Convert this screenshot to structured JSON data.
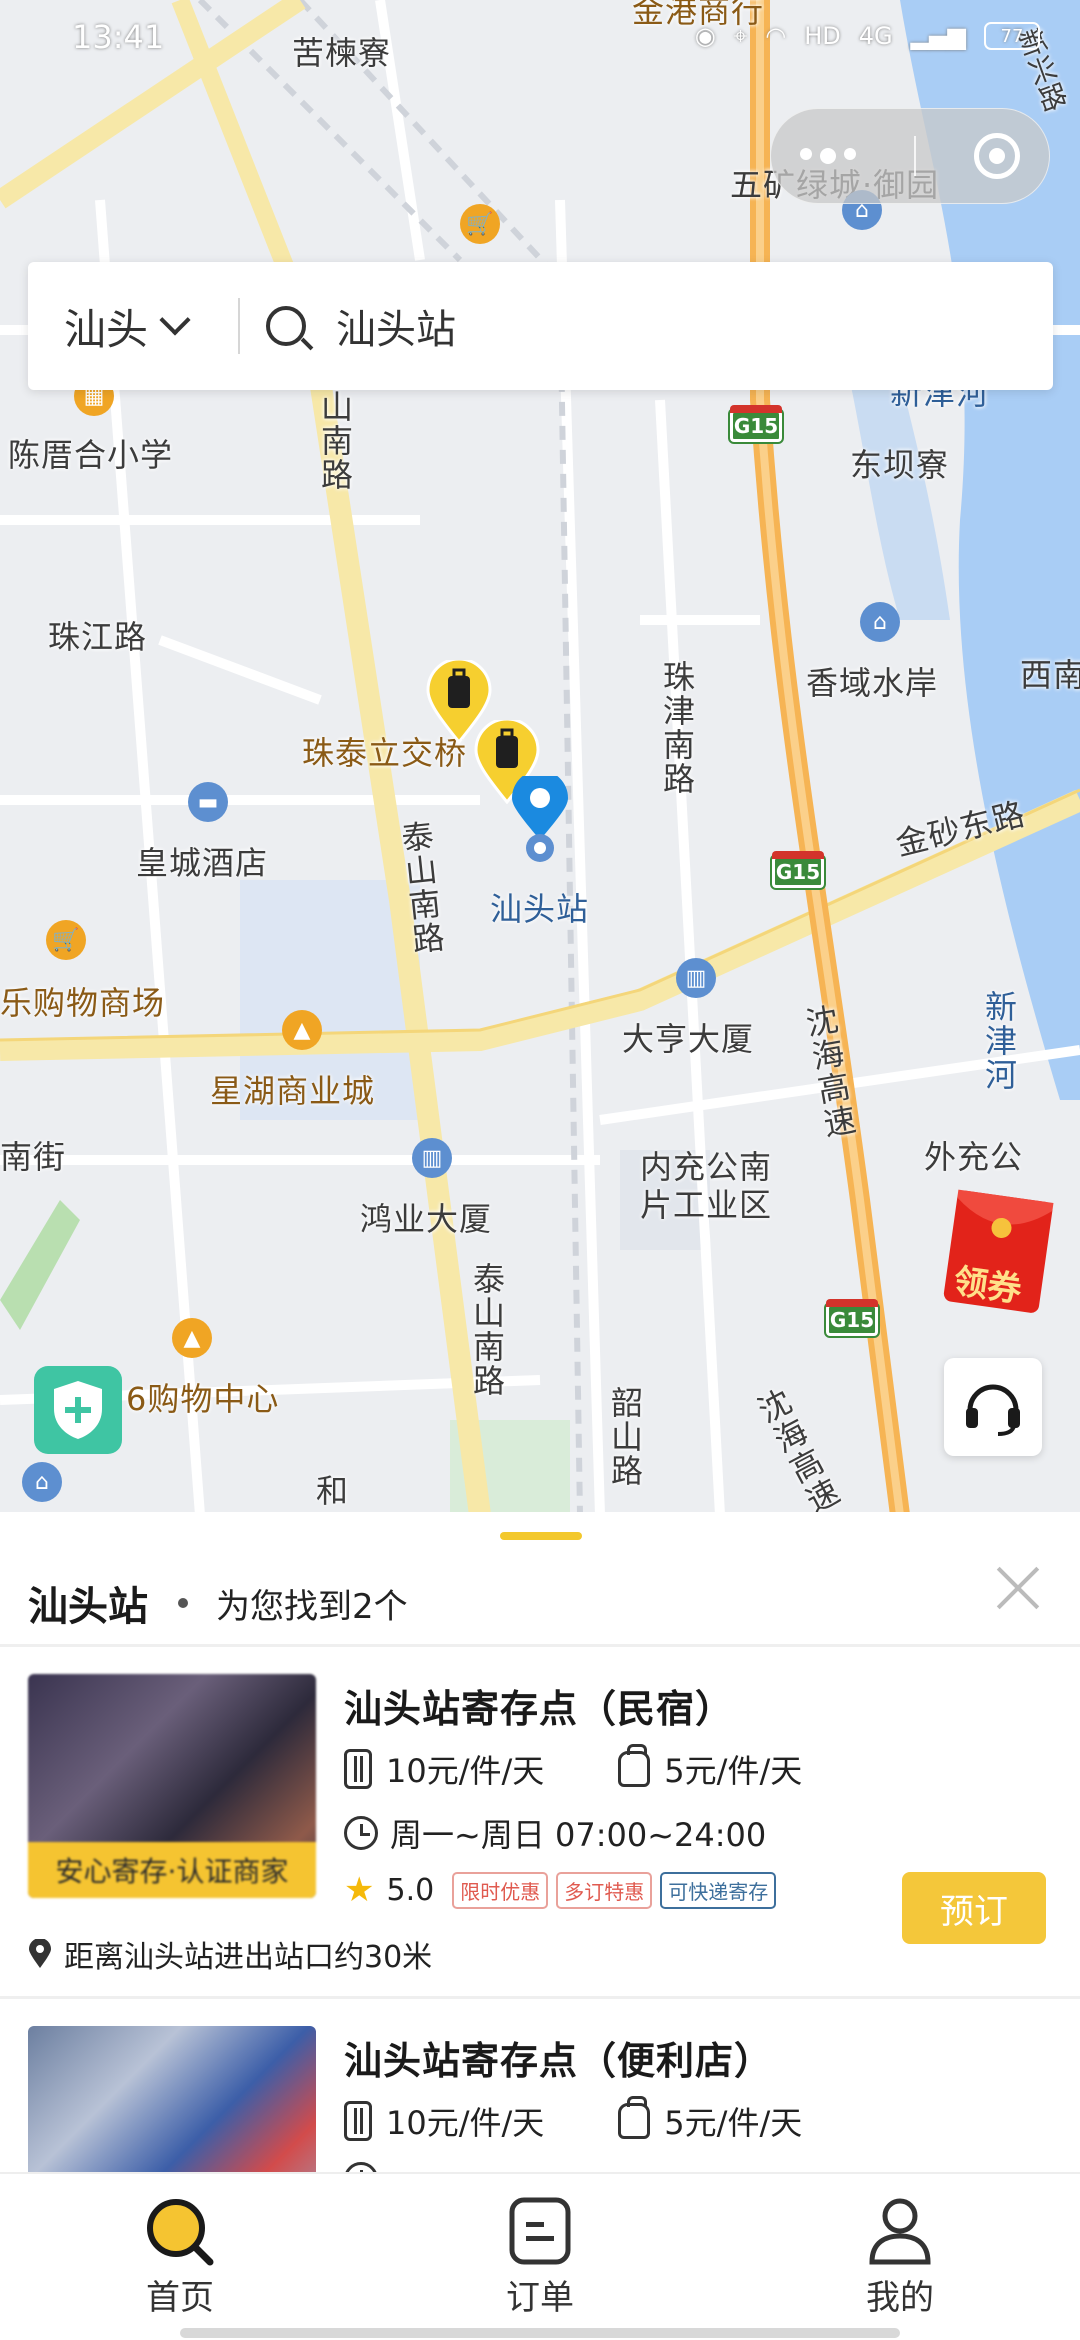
{
  "status_bar": {
    "time": "13:41",
    "network": "4G",
    "battery": "77",
    "hd": "HD"
  },
  "map": {
    "labels": [
      "苦楝寮",
      "金港商行",
      "五矿绿城·御园",
      "新兴路",
      "陈厝合小学",
      "新津河",
      "东坝寮",
      "山南路",
      "珠江路",
      "香域水岸",
      "西南",
      "珠泰立交桥",
      "珠津南路",
      "金砂东路",
      "皇城酒店",
      "泰山南路",
      "汕头站",
      "新津河",
      "乐购物商场",
      "大亨大厦",
      "沈海高速",
      "星湖商业城",
      "外充公",
      "南街",
      "内充公南片工业区",
      "鸿业大厦",
      "泰山南路",
      "6购物中心",
      "韶山路",
      "沈海高速",
      "和"
    ],
    "highway_shields": [
      "G15",
      "G15",
      "G15"
    ],
    "station_name": "汕头站"
  },
  "search": {
    "city": "汕头",
    "query": "汕头站"
  },
  "coupon": {
    "label": "领券"
  },
  "sheet": {
    "title": "汕头站",
    "count_text": "为您找到2个"
  },
  "results": [
    {
      "name": "汕头站寄存点（民宿）",
      "price_luggage": "10元/件/天",
      "price_bag": "5元/件/天",
      "hours": "周一~周日 07:00~24:00",
      "rating": "5.0",
      "tags": [
        "限时优惠",
        "多订特惠",
        "可快递寄存"
      ],
      "badge": "安心寄存·认证商家",
      "distance": "距离汕头站进出站口约30米",
      "book_label": "预订"
    },
    {
      "name": "汕头站寄存点（便利店）",
      "price_luggage": "10元/件/天",
      "price_bag": "5元/件/天"
    }
  ],
  "tabs": [
    {
      "label": "首页",
      "icon": "search-icon",
      "active": true
    },
    {
      "label": "订单",
      "icon": "order-icon",
      "active": false
    },
    {
      "label": "我的",
      "icon": "user-icon",
      "active": false
    }
  ],
  "colors": {
    "accent": "#F4C73A",
    "map_bg": "#ECEEF1",
    "water": "#A9CDF5",
    "highway": "#F6B454"
  }
}
